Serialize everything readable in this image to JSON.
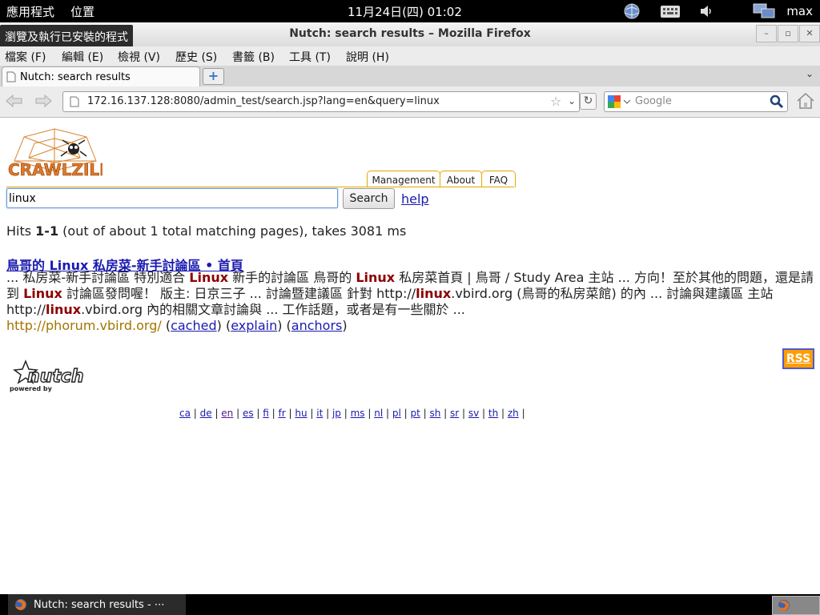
{
  "top_panel": {
    "apps_menu": "應用程式",
    "places_menu": "位置",
    "clock": "11月24日(四) 01:02",
    "user": "max"
  },
  "window": {
    "title": "Nutch: search results – Mozilla Firefox",
    "tooltip": "瀏覽及執行已安裝的程式"
  },
  "menubar": {
    "items": [
      {
        "label": "檔案",
        "key": "(F)"
      },
      {
        "label": "編輯",
        "key": "(E)"
      },
      {
        "label": "檢視",
        "key": "(V)"
      },
      {
        "label": "歷史",
        "key": "(S)"
      },
      {
        "label": "書籤",
        "key": "(B)"
      },
      {
        "label": "工具",
        "key": "(T)"
      },
      {
        "label": "說明",
        "key": "(H)"
      }
    ]
  },
  "tabs": {
    "active_label": "Nutch:  search  results",
    "new_tab": "+",
    "list_arrow": "⌄"
  },
  "navbar": {
    "url": "172.16.137.128:8080/admin_test/search.jsp?lang=en&query=linux",
    "search_placeholder": "Google"
  },
  "page": {
    "nav_tabs": [
      "Management",
      "About",
      "FAQ"
    ],
    "query": "linux",
    "search_button": "Search",
    "help_link": "help",
    "hits": {
      "prefix": "Hits ",
      "range": "1-1",
      "suffix": " (out of about 1 total matching pages), takes 3081 ms"
    },
    "result": {
      "title": "鳥哥的 Linux 私房菜-新手討論區 • 首頁",
      "summary_segments": [
        {
          "text": "... 私房菜-新手討論區 特別適合 ",
          "hl": false
        },
        {
          "text": "Linux",
          "hl": true
        },
        {
          "text": " 新手的討論區 鳥哥的 ",
          "hl": false
        },
        {
          "text": "Linux",
          "hl": true
        },
        {
          "text": " 私房菜首頁 | 鳥哥 / Study Area 主站 ... 方向！至於其他的問題，還是請到 ",
          "hl": false
        },
        {
          "text": "Linux",
          "hl": true
        },
        {
          "text": " 討論區發問喔！ 版主: 日京三子 ... 討論暨建議區 針對 http://",
          "hl": false
        },
        {
          "text": "linux",
          "hl": true
        },
        {
          "text": ".vbird.org (鳥哥的私房菜館) 的內 ... 討論與建議區 主站 http://",
          "hl": false
        },
        {
          "text": "linux",
          "hl": true
        },
        {
          "text": ".vbird.org 內的相關文章討論與 ... 工作話題，或者是有一些關於 ...",
          "hl": false
        }
      ],
      "url": "http://phorum.vbird.org/",
      "links": [
        "cached",
        "explain",
        "anchors"
      ]
    },
    "rss": "RSS",
    "nutch_tagline": "powered by",
    "nutch_brand": "nutch",
    "logo_text": "CRAWLZILLA",
    "languages": [
      "ca",
      "de",
      "en",
      "es",
      "fi",
      "fr",
      "hu",
      "it",
      "jp",
      "ms",
      "nl",
      "pl",
      "pt",
      "sh",
      "sr",
      "sv",
      "th",
      "zh"
    ],
    "current_language": "en"
  },
  "taskbar": {
    "item": "Nutch: search results - ⋯"
  },
  "colors": {
    "link": "#1a1ab0",
    "highlight": "#8b0000",
    "result_url": "#a37400",
    "tab_border": "#e3a800",
    "rss_bg": "#ff9d00"
  }
}
